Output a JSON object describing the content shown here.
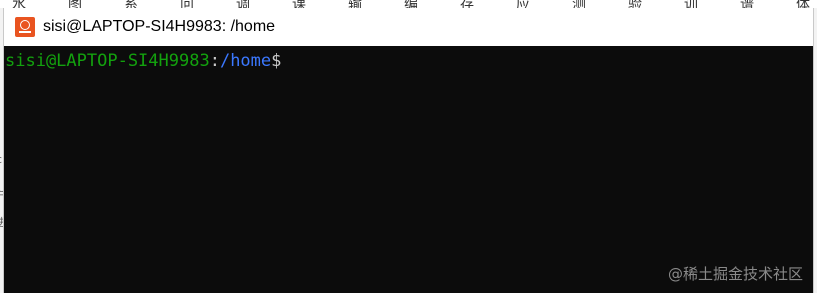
{
  "background": {
    "strip_fragments": [
      "水",
      "图",
      "系",
      "问",
      "调",
      "课",
      "输",
      "编",
      "存",
      "应",
      "测",
      "验",
      "训",
      "谱",
      "体"
    ],
    "left_fragments": [
      "c",
      "并",
      "进"
    ]
  },
  "window": {
    "title": "sisi@LAPTOP-SI4H9983: /home",
    "icon": "ubuntu-terminal-icon",
    "colors": {
      "background": "#0c0c0c",
      "user_host": "#13a10e",
      "path": "#3b78ff",
      "default_text": "#cccccc"
    }
  },
  "terminal": {
    "user_host": "sisi@LAPTOP-SI4H9983",
    "separator": ":",
    "path": "/home",
    "prompt_symbol": "$"
  },
  "watermark": {
    "text": "@稀土掘金技术社区"
  }
}
